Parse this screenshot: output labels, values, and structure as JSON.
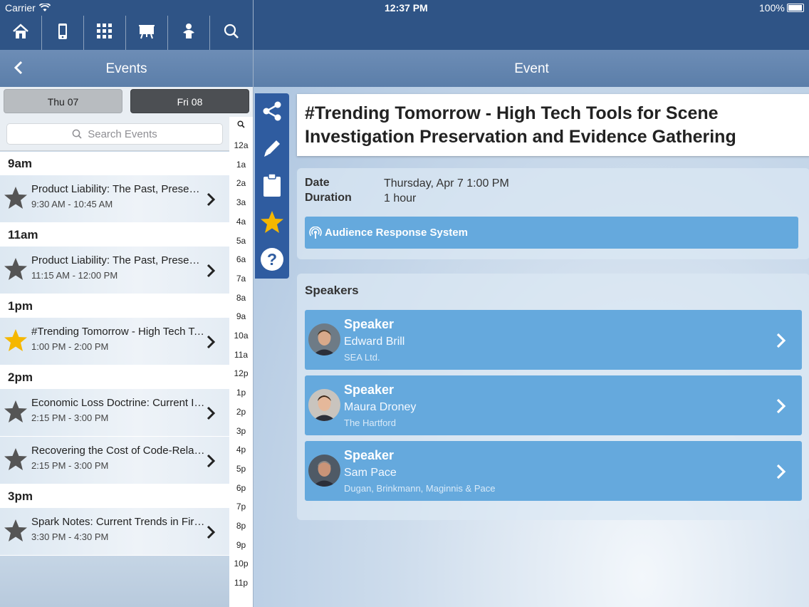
{
  "status_bar": {
    "carrier": "Carrier",
    "time": "12:37 PM",
    "battery": "100%"
  },
  "toolbar": {
    "buttons": [
      {
        "name": "home-icon"
      },
      {
        "name": "phone-icon"
      },
      {
        "name": "grid-icon"
      },
      {
        "name": "presentation-icon"
      },
      {
        "name": "exhibitor-icon"
      },
      {
        "name": "search-icon"
      }
    ]
  },
  "left_nav": {
    "title": "Events"
  },
  "day_tabs": [
    {
      "label": "Thu 07",
      "selected": false
    },
    {
      "label": "Fri 08",
      "selected": true
    }
  ],
  "search": {
    "placeholder": "Search Events"
  },
  "index_bar": [
    "12a",
    "1a",
    "2a",
    "3a",
    "4a",
    "5a",
    "6a",
    "7a",
    "8a",
    "9a",
    "10a",
    "11a",
    "12p",
    "1p",
    "2p",
    "3p",
    "4p",
    "5p",
    "6p",
    "7p",
    "8p",
    "9p",
    "10p",
    "11p"
  ],
  "event_groups": [
    {
      "header": "9am",
      "events": [
        {
          "title": "Product Liability: The Past, Present, and Future",
          "time": "9:30 AM - 10:45 AM",
          "favorite": false
        }
      ]
    },
    {
      "header": "11am",
      "events": [
        {
          "title": "Product Liability: The Past, Present, and Future",
          "time": "11:15 AM - 12:00 PM",
          "favorite": false
        }
      ]
    },
    {
      "header": "1pm",
      "events": [
        {
          "title": "#Trending Tomorrow - High Tech Tools for Scene Investigation",
          "time": "1:00 PM - 2:00 PM",
          "favorite": true
        }
      ]
    },
    {
      "header": "2pm",
      "events": [
        {
          "title": "Economic Loss Doctrine: Current Issues",
          "time": "2:15 PM - 3:00 PM",
          "favorite": false
        },
        {
          "title": "Recovering the Cost of Code-Related Upgrades",
          "time": "2:15 PM - 3:00 PM",
          "favorite": false
        }
      ]
    },
    {
      "header": "3pm",
      "events": [
        {
          "title": "Spark Notes: Current Trends in Fire Investigation",
          "time": "3:30 PM - 4:30 PM",
          "favorite": false
        }
      ]
    }
  ],
  "right_nav": {
    "title": "Event"
  },
  "event": {
    "title": "#Trending Tomorrow - High Tech Tools for Scene Investigation Preservation and Evidence Gathering",
    "date_label": "Date",
    "date_value": "Thursday, Apr 7 1:00 PM",
    "duration_label": "Duration",
    "duration_value": "1 hour",
    "audience_response": "Audience Response System",
    "speakers_heading": "Speakers",
    "speakers": [
      {
        "role": "Speaker",
        "name": "Edward Brill",
        "org": "SEA Ltd."
      },
      {
        "role": "Speaker",
        "name": "Maura Droney",
        "org": "The Hartford"
      },
      {
        "role": "Speaker",
        "name": "Sam Pace",
        "org": "Dugan, Brinkmann, Maginnis & Pace"
      }
    ]
  },
  "colors": {
    "header_blue": "#2f5486",
    "nav_blue": "#6d8db6",
    "card_blue": "#65a9dd",
    "favorite_gold": "#f5b700",
    "star_gray": "#555555"
  }
}
